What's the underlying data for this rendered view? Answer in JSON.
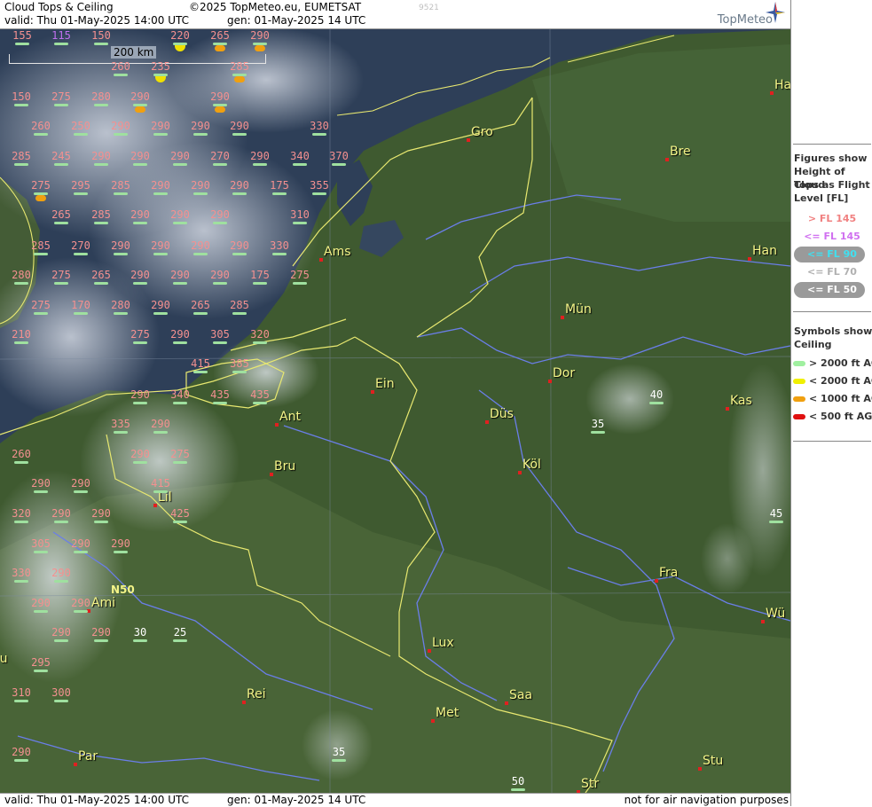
{
  "header": {
    "product": "Cloud Tops & Ceiling",
    "copyright": "©2025 TopMeteo.eu, EUMETSAT",
    "code": "9521",
    "valid": "valid:  Thu  01-May-2025  14:00 UTC",
    "gen": "gen: 01-May-2025 14 UTC",
    "logo": "TopMeteo"
  },
  "footer": {
    "valid": "valid:  Thu  01-May-2025  14:00 UTC",
    "gen": "gen: 01-May-2025 14 UTC",
    "note": "not for air navigation purposes"
  },
  "legend": {
    "heading": [
      "Figures show",
      "Height of Cloud",
      "Tops as Flight",
      "Level  [FL]"
    ],
    "levels": [
      {
        "label": "> FL 145",
        "color": "#f08080",
        "pill": false
      },
      {
        "label": "<= FL 145",
        "color": "#d070f0",
        "pill": false
      },
      {
        "label": "<= FL 90",
        "color": "#40e0f0",
        "pill": true
      },
      {
        "label": "<= FL 70",
        "color": "#b0b0b0",
        "pill": false
      },
      {
        "label": "<= FL 50",
        "color": "#ffffff",
        "pill": true
      }
    ],
    "symbols_heading": [
      "Symbols show",
      "Ceiling"
    ],
    "symbols": [
      {
        "label": "> 2000 ft AGL",
        "color": "#a0f0a0"
      },
      {
        "label": "< 2000 ft AGL",
        "color": "#f0f000"
      },
      {
        "label": "< 1000 ft AGL",
        "color": "#f0a010"
      },
      {
        "label": "< 500 ft AGL",
        "color": "#e01010"
      }
    ]
  },
  "map": {
    "scale": "200 km",
    "latlabel": "N50",
    "colors": {
      "high": "#f49090",
      "mid": "#c070f0",
      "low": "#ffffff",
      "ceiling_ok": "#9fe09f",
      "border": "#e8e870",
      "river": "#6a7ee8"
    },
    "cities": [
      {
        "name": "Gro"
      },
      {
        "name": "Bre"
      },
      {
        "name": "Ha"
      },
      {
        "name": "Ams"
      },
      {
        "name": "Han"
      },
      {
        "name": "Mün"
      },
      {
        "name": "Dor"
      },
      {
        "name": "Ein"
      },
      {
        "name": "Düs"
      },
      {
        "name": "Kas"
      },
      {
        "name": "Ant"
      },
      {
        "name": "Köl"
      },
      {
        "name": "Bru"
      },
      {
        "name": "Lil"
      },
      {
        "name": "Fra"
      },
      {
        "name": "Ami"
      },
      {
        "name": "Wü"
      },
      {
        "name": "Lux"
      },
      {
        "name": "Rei"
      },
      {
        "name": "Saa"
      },
      {
        "name": "Met"
      },
      {
        "name": "Par"
      },
      {
        "name": "Stu"
      },
      {
        "name": "Str"
      },
      {
        "name": "ou"
      }
    ],
    "cloud_tops": [
      "155",
      "115",
      "150",
      "220",
      "265",
      "290",
      "260",
      "235",
      "285",
      "150",
      "275",
      "280",
      "290",
      "290",
      "260",
      "250",
      "290",
      "290",
      "290",
      "290",
      "330",
      "285",
      "245",
      "290",
      "290",
      "290",
      "270",
      "290",
      "340",
      "370",
      "275",
      "295",
      "285",
      "290",
      "290",
      "290",
      "175",
      "355",
      "265",
      "285",
      "290",
      "290",
      "290",
      "310",
      "285",
      "270",
      "290",
      "290",
      "290",
      "290",
      "330",
      "280",
      "275",
      "265",
      "290",
      "290",
      "290",
      "175",
      "275",
      "275",
      "170",
      "280",
      "290",
      "265",
      "285",
      "210",
      "275",
      "290",
      "305",
      "320",
      "415",
      "385",
      "290",
      "340",
      "435",
      "435",
      "335",
      "290",
      "260",
      "290",
      "275",
      "290",
      "290",
      "415",
      "320",
      "290",
      "290",
      "425",
      "305",
      "290",
      "290",
      "330",
      "290",
      "290",
      "290",
      "30",
      "25",
      "290",
      "290",
      "295",
      "310",
      "300",
      "290",
      "40",
      "35",
      "45",
      "35",
      "50"
    ],
    "ceiling_symbols": [
      "yellow",
      "orange",
      "orange",
      "yellow",
      "orange",
      "orange",
      "orange",
      "orange"
    ]
  }
}
